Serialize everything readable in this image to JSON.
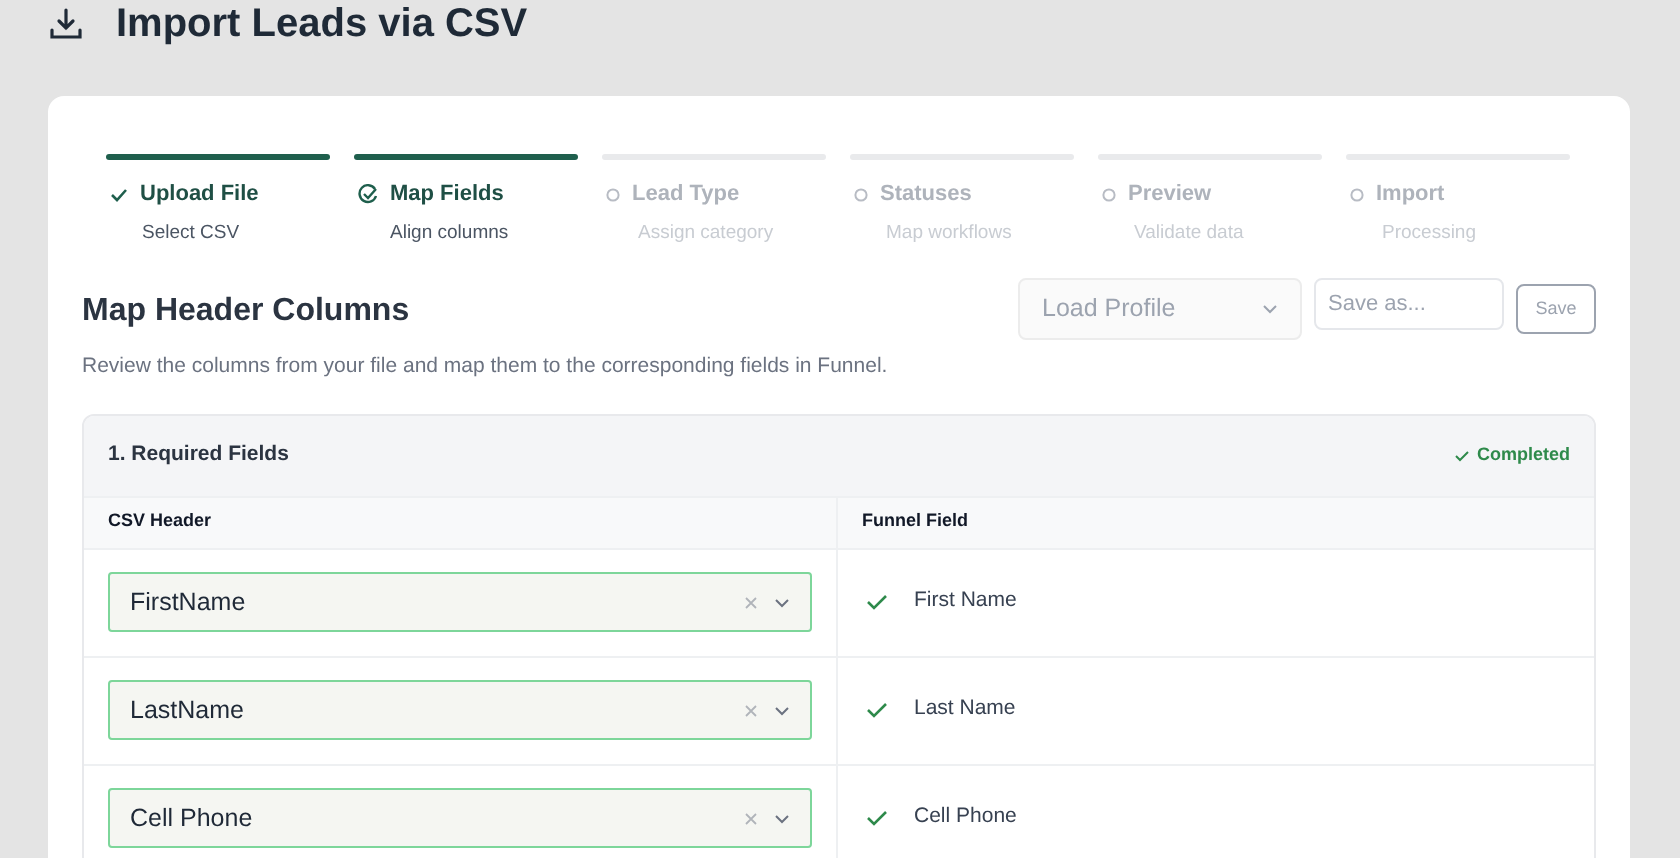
{
  "page": {
    "title": "Import Leads via CSV"
  },
  "steps": [
    {
      "label": "Upload File",
      "subtitle": "Select CSV",
      "kind": "done",
      "active": true
    },
    {
      "label": "Map Fields",
      "subtitle": "Align columns",
      "kind": "current",
      "active": true
    },
    {
      "label": "Lead Type",
      "subtitle": "Assign category",
      "kind": "pending",
      "active": false
    },
    {
      "label": "Statuses",
      "subtitle": "Map workflows",
      "kind": "pending",
      "active": false
    },
    {
      "label": "Preview",
      "subtitle": "Validate data",
      "kind": "pending",
      "active": false
    },
    {
      "label": "Import",
      "subtitle": "Processing",
      "kind": "pending",
      "active": false
    }
  ],
  "section": {
    "title": "Map Header Columns",
    "description": "Review the columns from your file and map them to the corresponding fields in Funnel."
  },
  "profile": {
    "select": "Load Profile",
    "save_placeholder": "Save as...",
    "save_button": "Save"
  },
  "group": {
    "title": "1. Required Fields",
    "status": "Completed",
    "completed": true,
    "columns": [
      "CSV Header",
      "Funnel Field"
    ],
    "rows": [
      {
        "csv_header": "FirstName",
        "funnel_field": "First Name",
        "matched": true
      },
      {
        "csv_header": "LastName",
        "funnel_field": "Last Name",
        "matched": true
      },
      {
        "csv_header": "Cell Phone",
        "funnel_field": "Cell Phone",
        "matched": true
      }
    ]
  }
}
